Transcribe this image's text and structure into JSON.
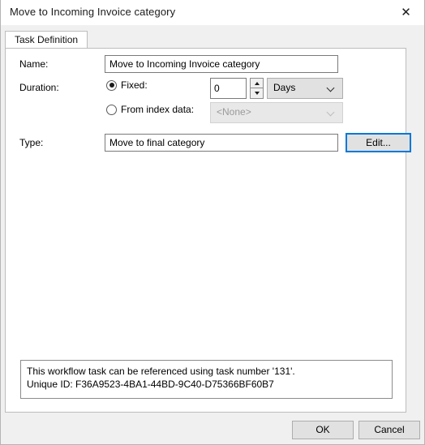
{
  "window": {
    "title": "Move to Incoming Invoice category",
    "close_glyph": "✕"
  },
  "tabs": [
    {
      "label": "Task Definition",
      "active": true
    }
  ],
  "form": {
    "name": {
      "label": "Name:",
      "value": "Move to Incoming Invoice category"
    },
    "duration": {
      "label": "Duration:",
      "fixed": {
        "label": "Fixed:",
        "selected": true,
        "value": "0",
        "unit": "Days"
      },
      "from_index_data": {
        "label": "From index data:",
        "selected": false,
        "value": "<None>",
        "disabled": true
      }
    },
    "type": {
      "label": "Type:",
      "value": "Move to final category",
      "edit_button": "Edit..."
    }
  },
  "info": {
    "line1": "This workflow task can be referenced using task number '131'.",
    "line2": "Unique ID: F36A9523-4BA1-44BD-9C40-D75366BF60B7"
  },
  "footer": {
    "ok": "OK",
    "cancel": "Cancel"
  },
  "colors": {
    "accent": "#0078d7",
    "window_bg": "#f0f0f0",
    "panel_bg": "#ffffff",
    "control_bg": "#e1e1e1",
    "disabled_text": "#9a9a9a"
  }
}
